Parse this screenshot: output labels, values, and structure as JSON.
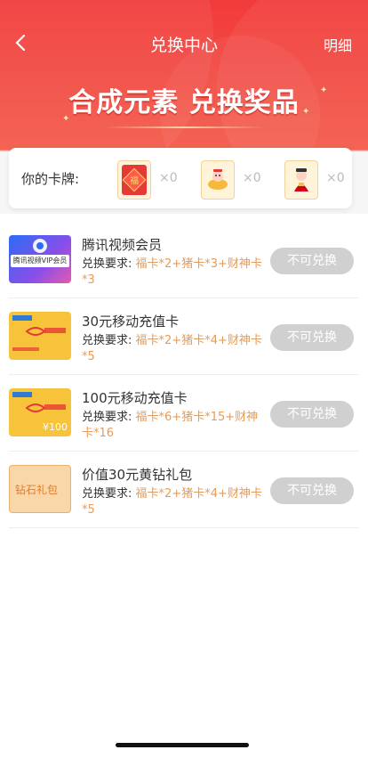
{
  "nav": {
    "title": "兑换中心",
    "detail": "明细",
    "back_icon": "chevron-left-icon"
  },
  "banner": {
    "text": "合成元素  兑换奖品"
  },
  "cards": {
    "label": "你的卡牌:",
    "items": [
      {
        "name": "福卡",
        "icon": "fu-card-icon",
        "count": "×0",
        "color": "#e53935"
      },
      {
        "name": "猪卡",
        "icon": "pig-card-icon",
        "count": "×0",
        "color": "#f5a623"
      },
      {
        "name": "财神卡",
        "icon": "wealth-god-card-icon",
        "count": "×0",
        "color": "#d0021b"
      }
    ]
  },
  "rewards": [
    {
      "name": "腾讯视频会员",
      "req_label": "兑换要求:",
      "req_value": "福卡*2+猪卡*3+财神卡*3",
      "button": "不可兑换",
      "thumb_text": "腾讯视频VIP会员",
      "thumb": "tencent-video-vip-icon"
    },
    {
      "name": "30元移动充值卡",
      "req_label": "兑换要求:",
      "req_value": "福卡*2+猪卡*4+财神卡*5",
      "button": "不可兑换",
      "thumb_text": "",
      "thumb": "mobile-recharge-card-icon"
    },
    {
      "name": "100元移动充值卡",
      "req_label": "兑换要求:",
      "req_value": "福卡*6+猪卡*15+财神卡*16",
      "button": "不可兑换",
      "thumb_text": "¥100",
      "thumb": "mobile-recharge-card-100-icon"
    },
    {
      "name": "价值30元黄钻礼包",
      "req_label": "兑换要求:",
      "req_value": "福卡*2+猪卡*4+财神卡*5",
      "button": "不可兑换",
      "thumb_text": "钻石礼包",
      "thumb": "diamond-gift-pack-icon"
    }
  ]
}
